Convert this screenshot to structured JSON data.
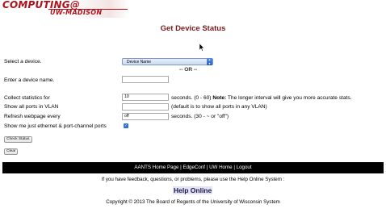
{
  "logo": {
    "line1": "COMPUTING@",
    "line2": "UW-MADISON"
  },
  "page_title": "Get Device Status",
  "form": {
    "select_device_label": "Select a device.",
    "device_select_value": "Device Name",
    "or_separator": "-- OR --",
    "enter_device_label": "Enter a device name.",
    "device_name_value": "",
    "collect_stats_label": "Collect statistics for",
    "collect_stats_value": "10",
    "collect_stats_unit": "seconds. (0 - 60)",
    "collect_stats_note_bold": "Note:",
    "collect_stats_note": "The longer interval will give you more accurate stats.",
    "show_ports_label": "Show all ports in VLAN",
    "show_ports_value": "",
    "show_ports_note": "(default is to show all ports in any VLAN)",
    "refresh_label": "Refresh webpage every",
    "refresh_value": "off",
    "refresh_note": "seconds. (30 - ~ or \"off\")",
    "show_ethernet_label": "Show me just ethernet & port-channel ports",
    "show_ethernet_checked": true,
    "check_status_button": "Check Status",
    "clear_button": "Clear"
  },
  "footer": {
    "links": [
      "AANTS Home Page",
      "EdgeConf",
      "UW Home",
      "Logout"
    ],
    "separator": " | ",
    "feedback_text": "If you have feedback, questions, or problems, please use the Help Online System :",
    "help_online": "Help Online",
    "copyright": "Copyright © 2013 The Board of Regents of the University of Wisconsin System"
  },
  "colors": {
    "logo_red": "#b0121b",
    "title_color": "#7a1a1a",
    "footer_bar": "#000000",
    "checkbox_blue": "#2f6fd6"
  }
}
